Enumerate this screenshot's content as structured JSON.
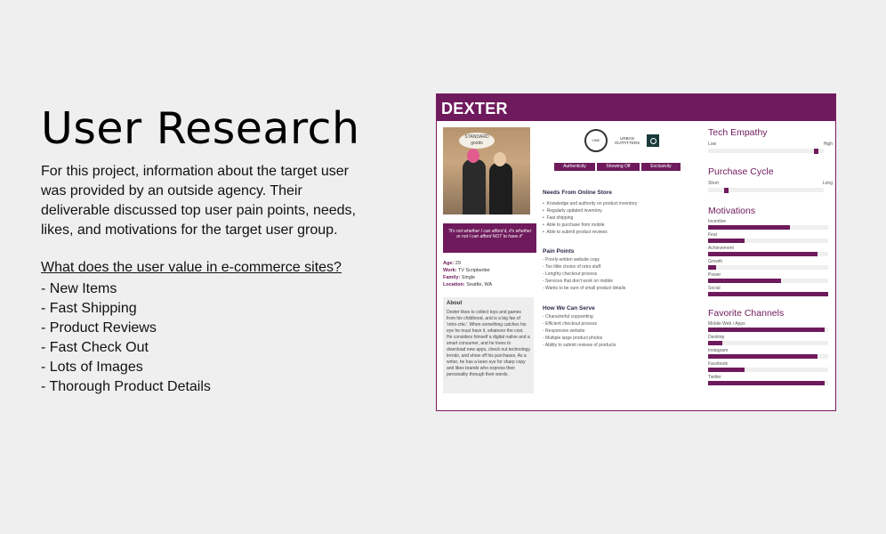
{
  "slide": {
    "title": "User Research",
    "intro": "For this project, information about the target user was provided by an outside agency. Their deliverable discussed top user pain points, needs, likes, and motivations for the target user group.",
    "question": "What does the user value in e-commerce sites?",
    "values": [
      "- New Items",
      "- Fast Shipping",
      "- Product Reviews",
      "- Fast Check Out",
      "- Lots of Images",
      "- Thorough Product Details"
    ]
  },
  "persona": {
    "name": "DEXTER",
    "photo_sign": "STANDARD goods",
    "quote": "\"It's not whether I can afford it, it's whether or not I can afford NOT to have it\"",
    "demographics": [
      {
        "label": "Age:",
        "value": "29"
      },
      {
        "label": "Work:",
        "value": "TV Scriptwriter"
      },
      {
        "label": "Family:",
        "value": "Single"
      },
      {
        "label": "Location:",
        "value": "Seattle, WA"
      }
    ],
    "about_title": "About",
    "about_text": "Dexter likes to collect toys and games from his childhood, and is a big fan of 'retro-chic'. When something catches his eye he must have it, whatever the cost. He considers himself a digital native and a smart consumer, and he loves to download new apps, check out technology trends, and show off his purchases. As a writer, he has a keen eye for sharp copy and likes brands who express their personality through their words.",
    "logos": {
      "seal": "ONE",
      "uo_line1": "URBAN",
      "uo_line2": "OUTFITTERS"
    },
    "tags": [
      "Authenticity",
      "Showing Off",
      "Exclusivity"
    ],
    "needs_title": "Needs From Online Store",
    "needs": [
      "Knowledge and authority on product inventory",
      "Regularly updated inventory",
      "Fast shipping",
      "Able to purchase from mobile",
      "Able to submit product reviews"
    ],
    "pain_title": "Pain Points",
    "pains": [
      "- Poorly-written website copy",
      "- Too little choice of retro stuff",
      "- Lengthy checkout process",
      "- Services that don't work on mobile",
      "- Wants to be sure of small product details"
    ],
    "serve_title": "How We Can Serve",
    "serve": [
      "- Characterful copywriting",
      "- Efficient checkout process",
      "- Responsive website",
      "- Multiple large product photos",
      "- Ability to submit reviews of products"
    ],
    "tech_empathy": {
      "title": "Tech Empathy",
      "low": "Low",
      "high": "High",
      "level": 0.95
    },
    "purchase_cycle": {
      "title": "Purchase Cycle",
      "short": "Short",
      "long": "Long",
      "level": 0.18
    },
    "motivations": {
      "title": "Motivations",
      "items": [
        {
          "label": "Incentive",
          "level": 0.68
        },
        {
          "label": "Fear",
          "level": 0.3
        },
        {
          "label": "Achievement",
          "level": 0.91
        },
        {
          "label": "Growth",
          "level": 0.07
        },
        {
          "label": "Power",
          "level": 0.61
        },
        {
          "label": "Social",
          "level": 1.0
        }
      ]
    },
    "channels": {
      "title": "Favorite Channels",
      "items": [
        {
          "label": "Mobile Web / Apps",
          "level": 0.97
        },
        {
          "label": "Desktop",
          "level": 0.12
        },
        {
          "label": "Instagram",
          "level": 0.91
        },
        {
          "label": "Facebook",
          "level": 0.3
        },
        {
          "label": "Twitter",
          "level": 0.97
        }
      ]
    },
    "accent_color": "#6e1a5c"
  }
}
